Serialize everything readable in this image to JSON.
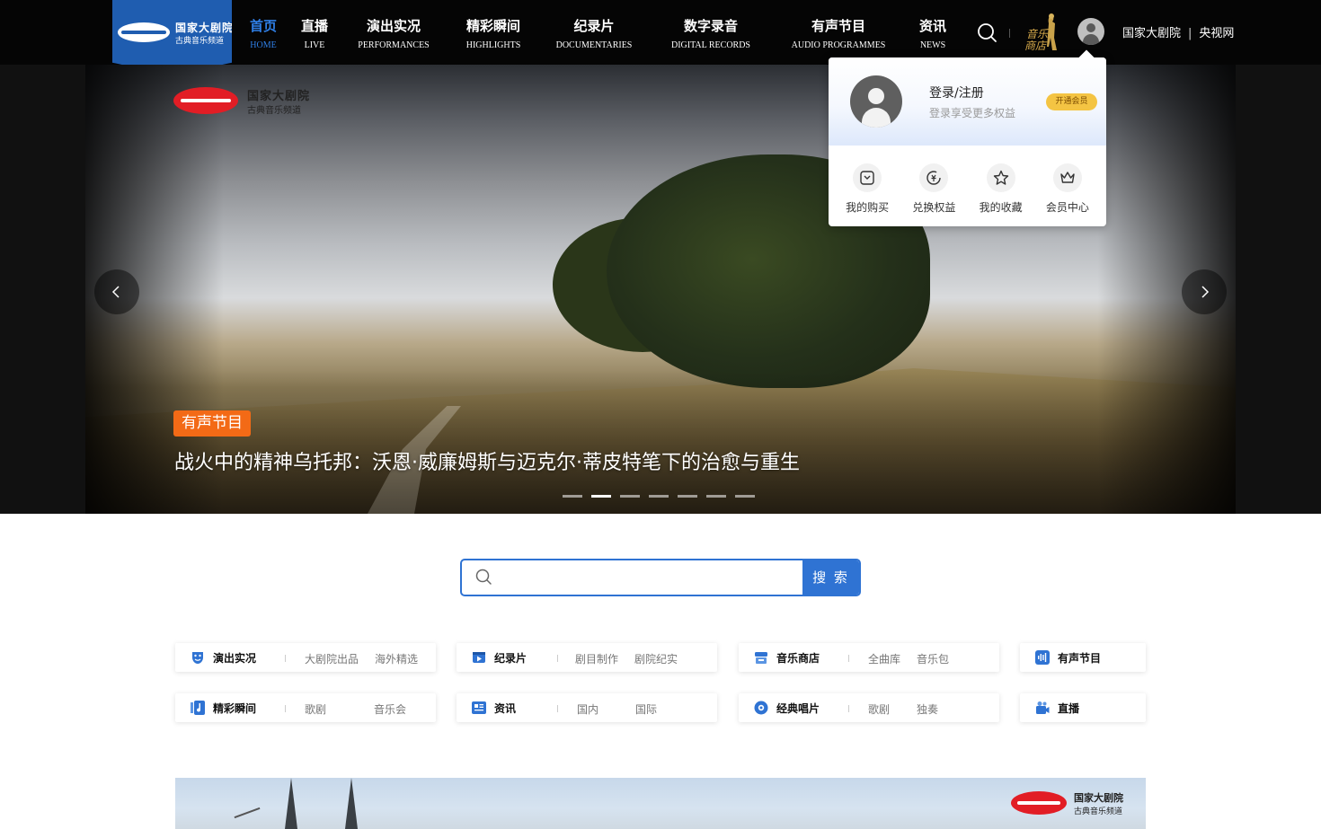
{
  "header": {
    "logo": {
      "line1": "国家大剧院",
      "line2": "古典音乐频道"
    },
    "nav": [
      {
        "cn": "首页",
        "en": "HOME",
        "active": true
      },
      {
        "cn": "直播",
        "en": "LIVE"
      },
      {
        "cn": "演出实况",
        "en": "PERFORMANCES"
      },
      {
        "cn": "精彩瞬间",
        "en": "HIGHLIGHTS"
      },
      {
        "cn": "纪录片",
        "en": "DOCUMENTARIES"
      },
      {
        "cn": "数字录音",
        "en": "DIGITAL RECORDS"
      },
      {
        "cn": "有声节目",
        "en": "AUDIO PROGRAMMES"
      },
      {
        "cn": "资讯",
        "en": "NEWS"
      }
    ],
    "store_label": [
      "音乐",
      "商店"
    ],
    "links": [
      "国家大剧院",
      "央视网"
    ],
    "link_separator": "|"
  },
  "hero": {
    "logo": {
      "line1": "国家大剧院",
      "line2": "古典音乐频道"
    },
    "badge": "有声节目",
    "title": "战火中的精神乌托邦：沃恩·威廉姆斯与迈克尔·蒂皮特笔下的治愈与重生",
    "slide_count": 7,
    "active_slide": 1
  },
  "user_dropdown": {
    "login_label": "登录/注册",
    "subtitle": "登录享受更多权益",
    "vip_button": "开通会员",
    "items": [
      {
        "icon": "purchase-icon",
        "label": "我的购买"
      },
      {
        "icon": "exchange-icon",
        "label": "兑换权益"
      },
      {
        "icon": "star-icon",
        "label": "我的收藏"
      },
      {
        "icon": "crown-icon",
        "label": "会员中心"
      }
    ]
  },
  "search": {
    "placeholder": "",
    "button": "搜 索"
  },
  "categories": {
    "row1": [
      {
        "title": "演出实况",
        "icon": "theater-mask-icon",
        "subs": [
          "大剧院出品",
          "海外精选"
        ]
      },
      {
        "title": "纪录片",
        "icon": "video-play-icon",
        "subs": [
          "剧目制作",
          "剧院纪实"
        ]
      },
      {
        "title": "音乐商店",
        "icon": "store-icon",
        "subs": [
          "全曲库",
          "音乐包"
        ]
      },
      {
        "title": "有声节目",
        "icon": "audio-wave-icon",
        "subs": []
      }
    ],
    "row2": [
      {
        "title": "精彩瞬间",
        "icon": "music-note-icon",
        "subs": [
          "歌剧",
          "音乐会"
        ]
      },
      {
        "title": "资讯",
        "icon": "news-icon",
        "subs": [
          "国内",
          "国际"
        ]
      },
      {
        "title": "经典唱片",
        "icon": "record-disc-icon",
        "subs": [
          "歌剧",
          "独奏"
        ]
      },
      {
        "title": "直播",
        "icon": "live-camera-icon",
        "subs": []
      }
    ]
  },
  "banner": {
    "logo": {
      "line1": "国家大剧院",
      "line2": "古典音乐频道"
    }
  },
  "colors": {
    "accent": "#2f73d3",
    "badge": "#f36a16",
    "header_bg": "#050505",
    "logo_blue": "#1f5db0",
    "logo_red": "#e21d25",
    "vip_gold": "#f4c443"
  }
}
